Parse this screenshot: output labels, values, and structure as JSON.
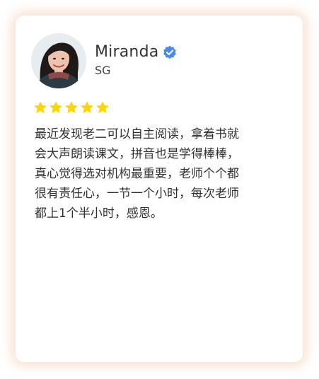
{
  "reviewer": {
    "name": "Miranda",
    "location": "SG",
    "verified": true,
    "avatar_icon": "avatar-photo"
  },
  "rating": {
    "stars": 5,
    "max": 5,
    "star_color": "#FFD600"
  },
  "review": {
    "text": "最近发现老二可以自主阅读，拿着书就\n会大声朗读课文，拼音也是学得棒棒，\n真心觉得选对机构最重要，老师个个都\n很有责任心，一节一个小时，每次老师\n都上1个半小时，感恩。"
  },
  "colors": {
    "verified_badge": "#4A88F0",
    "card_glow": "#F0C8AA"
  }
}
